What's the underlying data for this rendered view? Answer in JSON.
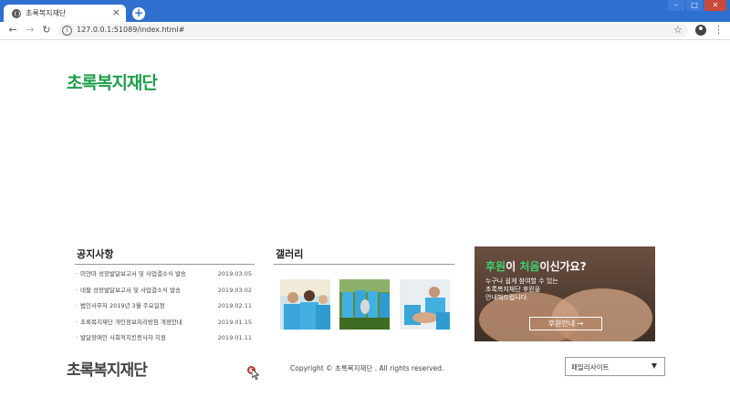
{
  "browser": {
    "tab_title": "초록복지재단",
    "tab_close": "×",
    "new_tab": "+",
    "url": "127.0.0.1:51089/index.html#",
    "nav": {
      "back": "←",
      "forward": "→",
      "reload": "↻"
    },
    "star": "☆",
    "menu": "⋮",
    "window_controls": {
      "minimize": "–",
      "maximize": "□",
      "close": "✕"
    }
  },
  "header": {
    "logo": "초록복지재단"
  },
  "notice": {
    "title": "공지사항",
    "items": [
      {
        "text": "미얀마 성장발달보고서 및 사업결소식 발송",
        "date": "2019.03.05"
      },
      {
        "text": "네팔 성장발달보고서 및 사업결소식 발송",
        "date": "2019.03.02"
      },
      {
        "text": "법인사무처 2019년 3월 주요일정",
        "date": "2019.02.11"
      },
      {
        "text": "초록복지재단 개인정보처리방침 개정안내",
        "date": "2019.01.15"
      },
      {
        "text": "발달장애인 사회적치킨봉사자 지원",
        "date": "2019.01.11"
      }
    ]
  },
  "gallery": {
    "title": "갤러리"
  },
  "donate": {
    "question_pre": "후원",
    "question_mid": "이 ",
    "question_hl": "처음",
    "question_post": "이신가요?",
    "desc_line1": "누구나 쉽게 참여할 수 있는",
    "desc_line2": "초록복지재단 후원을",
    "desc_line3": "안내해드립니다.",
    "button": "후원안내 →"
  },
  "footer": {
    "logo": "초록복지재단",
    "copyright": "Copyright © 초록복지재단 . All rights reserved.",
    "family_site": "패밀리사이트",
    "family_arrow": "▼"
  },
  "colors": {
    "brand_green": "#1e9e4a",
    "highlight_green": "#3ad16b",
    "browser_blue": "#2f6fcf"
  }
}
